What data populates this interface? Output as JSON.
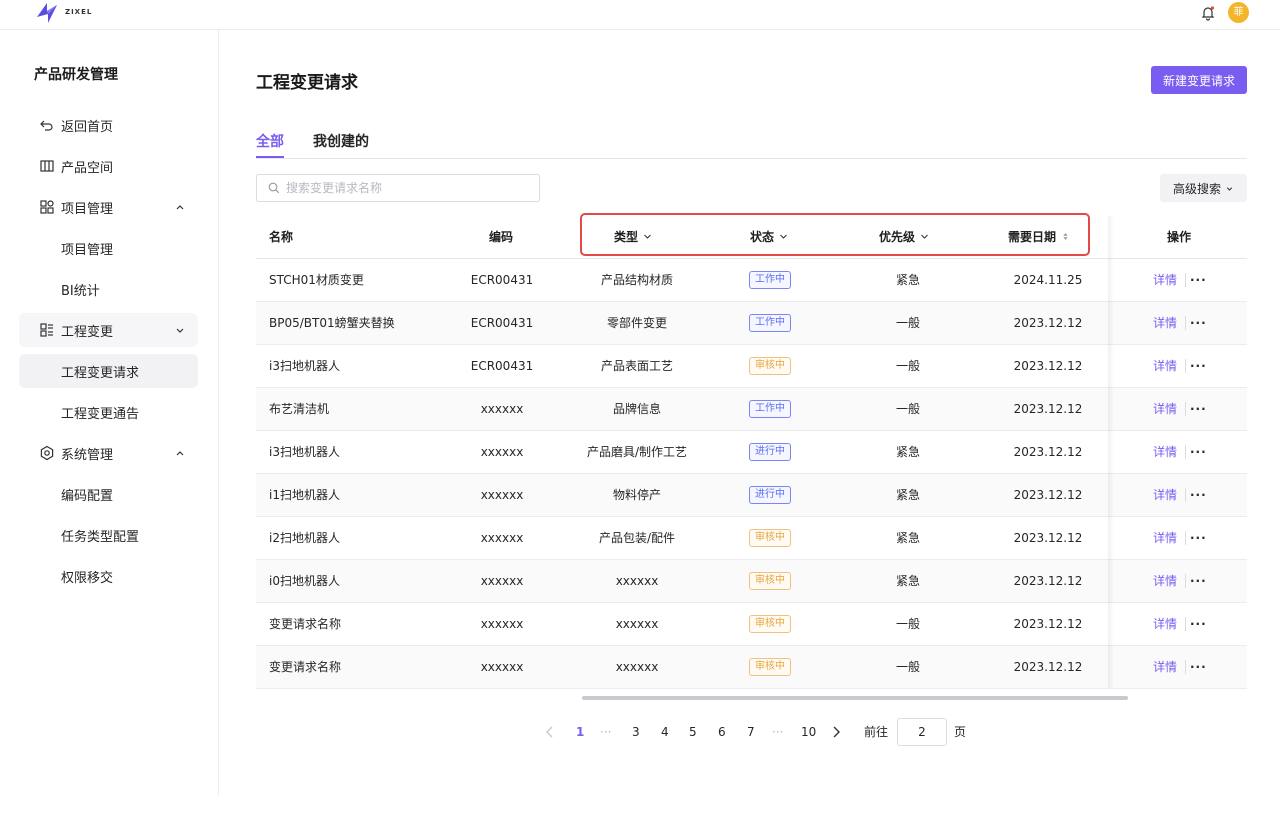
{
  "header": {
    "brand": "ZIXEL",
    "avatar_text": "菲"
  },
  "sidebar": {
    "title": "产品研发管理",
    "items": [
      {
        "label": "返回首页"
      },
      {
        "label": "产品空间"
      },
      {
        "label": "项目管理"
      },
      {
        "label": "项目管理"
      },
      {
        "label": "BI统计"
      },
      {
        "label": "工程变更"
      },
      {
        "label": "工程变更请求"
      },
      {
        "label": "工程变更通告"
      },
      {
        "label": "系统管理"
      },
      {
        "label": "编码配置"
      },
      {
        "label": "任务类型配置"
      },
      {
        "label": "权限移交"
      }
    ]
  },
  "page": {
    "title": "工程变更请求",
    "new_button": "新建变更请求",
    "tabs": [
      {
        "label": "全部"
      },
      {
        "label": "我创建的"
      }
    ],
    "search_placeholder": "搜索变更请求名称",
    "advanced_search": "高级搜索"
  },
  "table": {
    "columns": [
      "名称",
      "编码",
      "类型",
      "状态",
      "优先级",
      "需要日期",
      "操作"
    ],
    "rows": [
      {
        "name": "STCH01材质变更",
        "code": "ECR00431",
        "type": "产品结构材质",
        "status": "工作中",
        "status_color": "#5b6ef5",
        "priority": "紧急",
        "date": "2024.11.25",
        "detail": "详情",
        "more": "···"
      },
      {
        "name": "BP05/BT01螃蟹夹替换",
        "code": "ECR00431",
        "type": "零部件变更",
        "status": "工作中",
        "status_color": "#5b6ef5",
        "priority": "一般",
        "date": "2023.12.12",
        "detail": "详情",
        "more": "···"
      },
      {
        "name": "i3扫地机器人",
        "code": "ECR00431",
        "type": "产品表面工艺",
        "status": "审核中",
        "status_color": "#e8a640",
        "priority": "一般",
        "date": "2023.12.12",
        "detail": "详情",
        "more": "···"
      },
      {
        "name": "布艺清洁机",
        "code": "xxxxxx",
        "type": "品牌信息",
        "status": "工作中",
        "status_color": "#5b6ef5",
        "priority": "一般",
        "date": "2023.12.12",
        "detail": "详情",
        "more": "···"
      },
      {
        "name": "i3扫地机器人",
        "code": "xxxxxx",
        "type": "产品磨具/制作工艺",
        "status": "进行中",
        "status_color": "#5b6ef5",
        "priority": "紧急",
        "date": "2023.12.12",
        "detail": "详情",
        "more": "···"
      },
      {
        "name": "i1扫地机器人",
        "code": "xxxxxx",
        "type": "物料停产",
        "status": "进行中",
        "status_color": "#5b6ef5",
        "priority": "紧急",
        "date": "2023.12.12",
        "detail": "详情",
        "more": "···"
      },
      {
        "name": "i2扫地机器人",
        "code": "xxxxxx",
        "type": "产品包装/配件",
        "status": "审核中",
        "status_color": "#e8a640",
        "priority": "紧急",
        "date": "2023.12.12",
        "detail": "详情",
        "more": "···"
      },
      {
        "name": "i0扫地机器人",
        "code": "xxxxxx",
        "type": "xxxxxx",
        "status": "审核中",
        "status_color": "#e8a640",
        "priority": "紧急",
        "date": "2023.12.12",
        "detail": "详情",
        "more": "···"
      },
      {
        "name": "变更请求名称",
        "code": "xxxxxx",
        "type": "xxxxxx",
        "status": "审核中",
        "status_color": "#e8a640",
        "priority": "一般",
        "date": "2023.12.12",
        "detail": "详情",
        "more": "···"
      },
      {
        "name": "变更请求名称",
        "code": "xxxxxx",
        "type": "xxxxxx",
        "status": "审核中",
        "status_color": "#e8a640",
        "priority": "一般",
        "date": "2023.12.12",
        "detail": "详情",
        "more": "···"
      }
    ]
  },
  "pagination": {
    "pages": [
      "1",
      "···",
      "3",
      "4",
      "5",
      "6",
      "7",
      "···",
      "10"
    ],
    "current": "1",
    "goto_label": "前往",
    "goto_value": "2",
    "page_suffix": "页"
  },
  "colors": {
    "accent": "#7b5cf0",
    "highlight_border": "#e64848",
    "avatar": "#f4b52a"
  },
  "icons": [
    "logo-icon",
    "bell-icon",
    "return-icon",
    "product-space-icon",
    "project-icon",
    "engineering-change-icon",
    "settings-icon",
    "chevron-up-icon",
    "chevron-down-icon",
    "search-icon",
    "sort-icon",
    "more-icon",
    "prev-page-icon",
    "next-page-icon"
  ]
}
